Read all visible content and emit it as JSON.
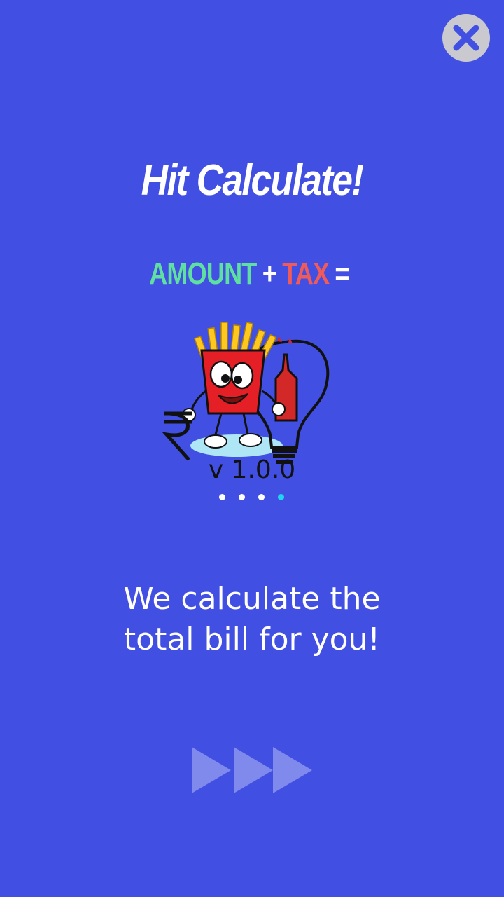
{
  "close_button": {
    "icon": "close-icon"
  },
  "title": "Hit Calculate!",
  "formula": {
    "amount": "AMOUNT",
    "plus": "+",
    "tax": "TAX",
    "equals": "="
  },
  "logo": {
    "icon": "fries-rupee-bulb-logo"
  },
  "version": "v 1.0.0",
  "pager": {
    "total": 4,
    "active_index": 3
  },
  "description": {
    "line1": "We calculate the",
    "line2": "total bill for you!"
  },
  "next_button": {
    "icon": "fast-forward-icon"
  },
  "colors": {
    "background": "#4150e3",
    "amount": "#5fe0a0",
    "tax": "#ef5a5a",
    "active_dot": "#22d3f0"
  }
}
